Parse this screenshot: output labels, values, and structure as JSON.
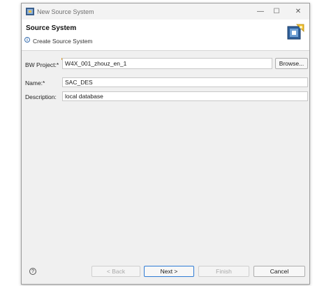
{
  "window": {
    "title": "New Source System",
    "controls": {
      "minimize": "—",
      "maximize": "☐",
      "close": "✕"
    }
  },
  "header": {
    "title": "Source System",
    "subtitle": "Create Source System",
    "info_icon": "i"
  },
  "form": {
    "bw_project": {
      "label": "BW Project:*",
      "value": "W4X_001_zhouz_en_1"
    },
    "browse_label": "Browse...",
    "name": {
      "label": "Name:*",
      "value": "SAC_DES"
    },
    "description": {
      "label": "Description:",
      "value": "local database"
    }
  },
  "footer": {
    "help_icon": "?",
    "back_label": "< Back",
    "next_label": "Next >",
    "finish_label": "Finish",
    "cancel_label": "Cancel"
  },
  "colors": {
    "accent": "#2f7bd4",
    "window_bg": "#f0f0f0",
    "header_bg": "#ffffff"
  }
}
